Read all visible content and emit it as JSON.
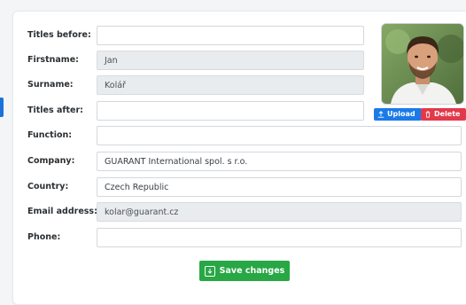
{
  "colors": {
    "accent": "#1a73d9",
    "upload": "#1a7be8",
    "delete": "#e2394a",
    "save": "#28a745",
    "readonly_bg": "#e9ecef"
  },
  "form": {
    "titles_before": {
      "label": "Titles before:",
      "value": ""
    },
    "firstname": {
      "label": "Firstname:",
      "value": "Jan"
    },
    "surname": {
      "label": "Surname:",
      "value": "Kolář"
    },
    "titles_after": {
      "label": "Titles after:",
      "value": ""
    },
    "function": {
      "label": "Function:",
      "value": ""
    },
    "company": {
      "label": "Company:",
      "value": "GUARANT International spol. s r.o."
    },
    "country": {
      "label": "Country:",
      "value": "Czech Republic"
    },
    "email": {
      "label": "Email address:",
      "value": "kolar@guarant.cz"
    },
    "phone": {
      "label": "Phone:",
      "value": ""
    }
  },
  "photo": {
    "upload_label": "Upload",
    "delete_label": "Delete",
    "upload_icon": "upload-icon",
    "delete_icon": "trash-icon"
  },
  "actions": {
    "save_label": "Save changes",
    "save_icon": "save-icon"
  }
}
